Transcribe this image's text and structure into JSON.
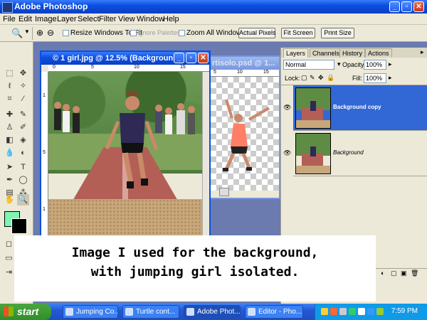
{
  "app": {
    "title": "Adobe Photoshop"
  },
  "menu": [
    "File",
    "Edit",
    "Image",
    "Layer",
    "Select",
    "Filter",
    "View",
    "Window",
    "Help"
  ],
  "options": {
    "resize_windows": "Resize Windows To Fit",
    "ignore_palettes": "Ignore Palettes",
    "zoom_all": "Zoom All Windows",
    "actual_pixels": "Actual Pixels",
    "fit_screen": "Fit Screen",
    "print_size": "Print Size"
  },
  "documents": {
    "main": {
      "title": "© 1 girl.jpg @ 12.5% (Backgroun...",
      "ruler_h": [
        "0",
        "5",
        "10",
        "15"
      ],
      "ruler_v": [
        "1",
        "5",
        "1"
      ]
    },
    "second": {
      "title": "rtisolo.psd @ 1...",
      "ruler_h": [
        "5",
        "10",
        "15"
      ]
    }
  },
  "layers_panel": {
    "tabs": [
      "Layers",
      "Channels",
      "History",
      "Actions"
    ],
    "blend_mode": "Normal",
    "opacity_label": "Opacity:",
    "opacity_value": "100%",
    "lock_label": "Lock:",
    "fill_label": "Fill:",
    "fill_value": "100%",
    "layers": [
      {
        "name": "Background copy",
        "selected": true
      },
      {
        "name": "Background",
        "selected": false
      }
    ]
  },
  "caption": {
    "line1": "Image I used for the background,",
    "line2": "with jumping girl isolated."
  },
  "taskbar": {
    "start": "start",
    "tasks": [
      "Jumping Co...",
      "Turtle cont...",
      "Adobe Phot...",
      "Editor - Pho..."
    ],
    "clock": "7:59 PM"
  }
}
